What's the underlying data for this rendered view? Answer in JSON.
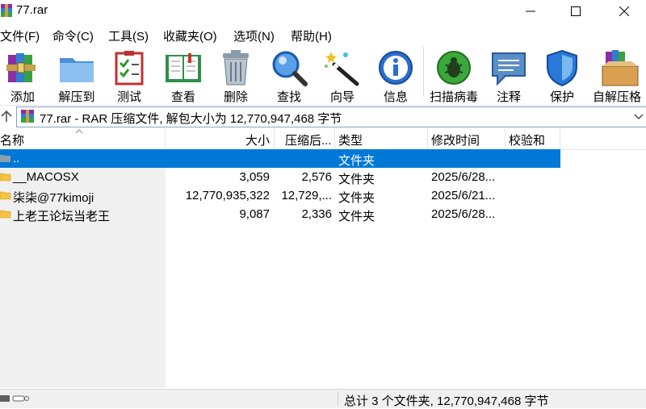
{
  "window": {
    "title": "77.rar"
  },
  "menu": [
    "文件(F)",
    "命令(C)",
    "工具(S)",
    "收藏夹(O)",
    "选项(N)",
    "帮助(H)"
  ],
  "toolbar": [
    {
      "label": "添加",
      "icon": "add-books-icon"
    },
    {
      "label": "解压到",
      "icon": "extract-folder-icon"
    },
    {
      "label": "测试",
      "icon": "test-checklist-icon"
    },
    {
      "label": "查看",
      "icon": "view-book-icon"
    },
    {
      "label": "删除",
      "icon": "trash-can-icon"
    },
    {
      "label": "查找",
      "icon": "magnifier-icon"
    },
    {
      "label": "向导",
      "icon": "wizard-wand-icon"
    },
    {
      "label": "信息",
      "icon": "info-icon"
    },
    {
      "label": "扫描病毒",
      "icon": "virus-scan-icon"
    },
    {
      "label": "注释",
      "icon": "comment-icon"
    },
    {
      "label": "保护",
      "icon": "shield-icon"
    },
    {
      "label": "自解压格",
      "icon": "sfx-box-icon"
    }
  ],
  "address": {
    "text": "77.rar - RAR 压缩文件, 解包大小为 12,770,947,468 字节"
  },
  "columns": [
    "名称",
    "大小",
    "压缩后...",
    "类型",
    "修改时间",
    "校验和"
  ],
  "rows": [
    {
      "name": "..",
      "size": "",
      "packed": "",
      "type": "文件夹",
      "modified": "",
      "crc": "",
      "selected": true
    },
    {
      "name": "__MACOSX",
      "size": "3,059",
      "packed": "2,576",
      "type": "文件夹",
      "modified": "2025/6/28...",
      "crc": ""
    },
    {
      "name": "柒柒@77kimoji",
      "size": "12,770,935,322",
      "packed": "12,729,...",
      "type": "文件夹",
      "modified": "2025/6/21...",
      "crc": ""
    },
    {
      "name": "上老王论坛当老王",
      "size": "9,087",
      "packed": "2,336",
      "type": "文件夹",
      "modified": "2025/6/28...",
      "crc": ""
    }
  ],
  "status": {
    "text": "总计 3 个文件夹, 12,770,947,468 字节"
  },
  "colors": {
    "selection": "#0078d7",
    "folder": "#f5c242",
    "statusbar": "#f0f0f0"
  }
}
